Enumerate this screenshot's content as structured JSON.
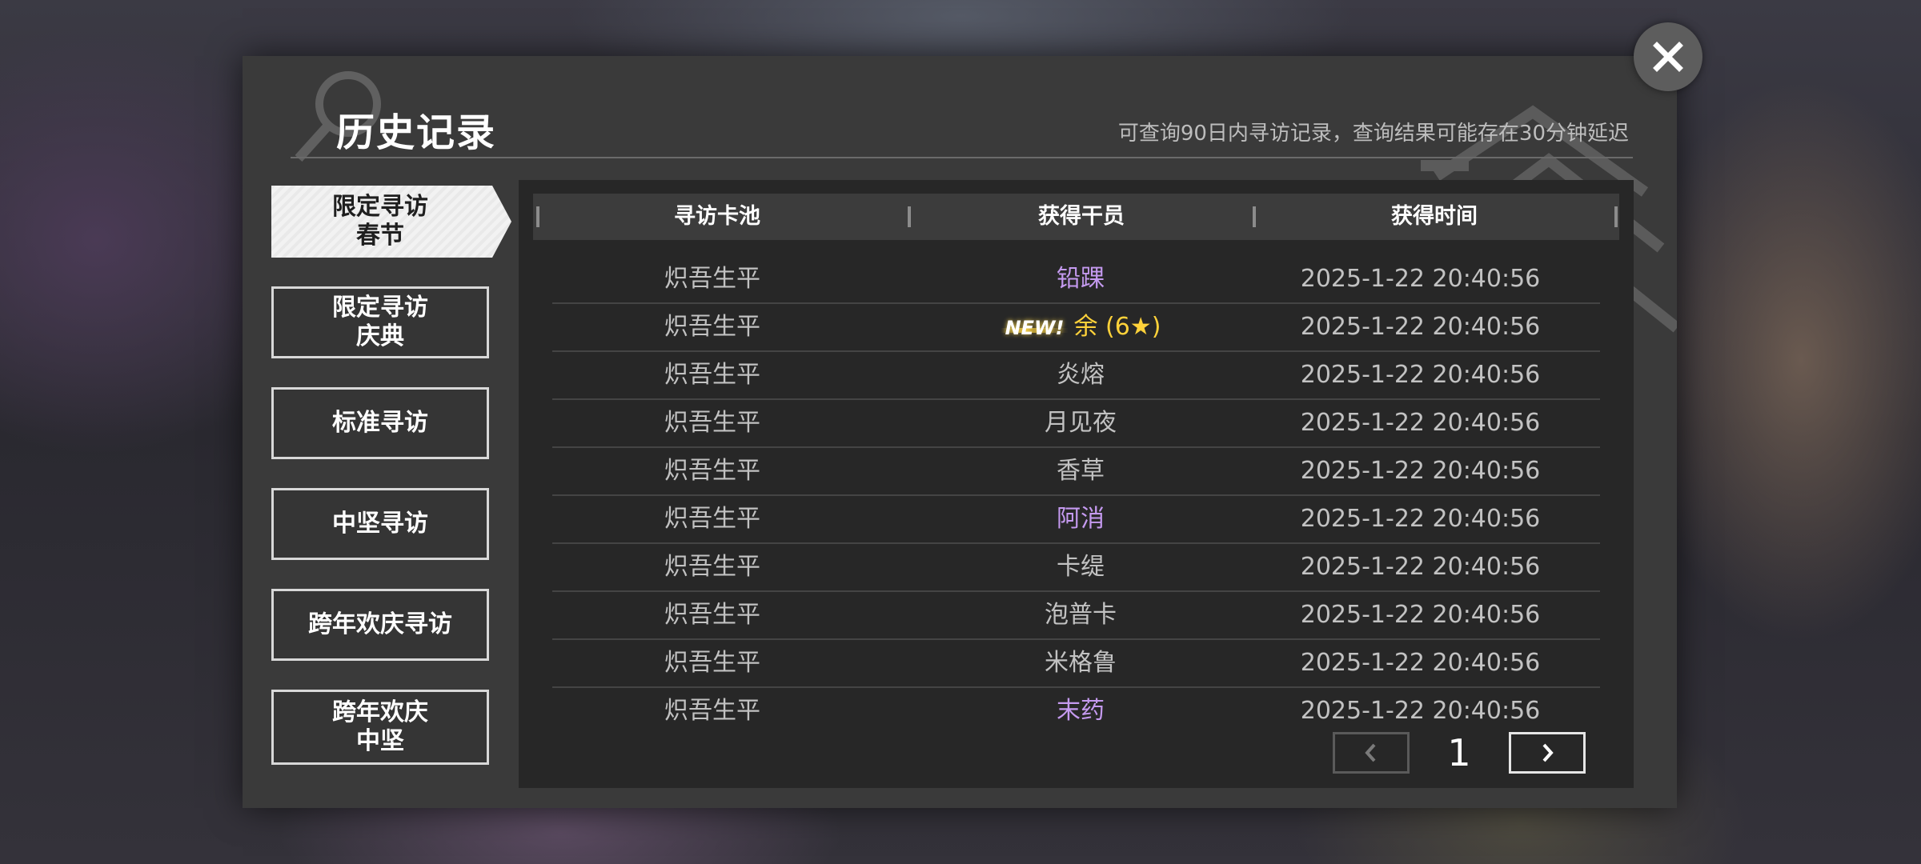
{
  "header": {
    "title": "历史记录",
    "hint": "可查询90日内寻访记录，查询结果可能存在30分钟延迟"
  },
  "sidebar": {
    "items": [
      {
        "line1": "限定寻访",
        "line2": "春节",
        "active": true
      },
      {
        "line1": "限定寻访",
        "line2": "庆典",
        "active": false
      },
      {
        "line1": "标准寻访",
        "line2": "",
        "active": false
      },
      {
        "line1": "中坚寻访",
        "line2": "",
        "active": false
      },
      {
        "line1": "跨年欢庆寻访",
        "line2": "",
        "active": false
      },
      {
        "line1": "跨年欢庆",
        "line2": "中坚",
        "active": false
      }
    ]
  },
  "table": {
    "headers": [
      "寻访卡池",
      "获得干员",
      "获得时间"
    ],
    "rows": [
      {
        "pool": "炽吾生平",
        "operator": "铅踝",
        "time": "2025-1-22 20:40:56",
        "rarity_color": "#c59af0",
        "new": ""
      },
      {
        "pool": "炽吾生平",
        "operator": "余 (6★)",
        "time": "2025-1-22 20:40:56",
        "rarity_color": "#ffd23a",
        "new": "NEW!"
      },
      {
        "pool": "炽吾生平",
        "operator": "炎熔",
        "time": "2025-1-22 20:40:56",
        "rarity_color": "#c2c2c2",
        "new": ""
      },
      {
        "pool": "炽吾生平",
        "operator": "月见夜",
        "time": "2025-1-22 20:40:56",
        "rarity_color": "#c2c2c2",
        "new": ""
      },
      {
        "pool": "炽吾生平",
        "operator": "香草",
        "time": "2025-1-22 20:40:56",
        "rarity_color": "#c2c2c2",
        "new": ""
      },
      {
        "pool": "炽吾生平",
        "operator": "阿消",
        "time": "2025-1-22 20:40:56",
        "rarity_color": "#c59af0",
        "new": ""
      },
      {
        "pool": "炽吾生平",
        "operator": "卡缇",
        "time": "2025-1-22 20:40:56",
        "rarity_color": "#c2c2c2",
        "new": ""
      },
      {
        "pool": "炽吾生平",
        "operator": "泡普卡",
        "time": "2025-1-22 20:40:56",
        "rarity_color": "#c2c2c2",
        "new": ""
      },
      {
        "pool": "炽吾生平",
        "operator": "米格鲁",
        "time": "2025-1-22 20:40:56",
        "rarity_color": "#c2c2c2",
        "new": ""
      },
      {
        "pool": "炽吾生平",
        "operator": "末药",
        "time": "2025-1-22 20:40:56",
        "rarity_color": "#c59af0",
        "new": ""
      }
    ]
  },
  "pager": {
    "current_page": "1",
    "prev_icon": "chevron-left-icon",
    "next_icon": "chevron-right-icon"
  },
  "close_icon": "close-icon"
}
